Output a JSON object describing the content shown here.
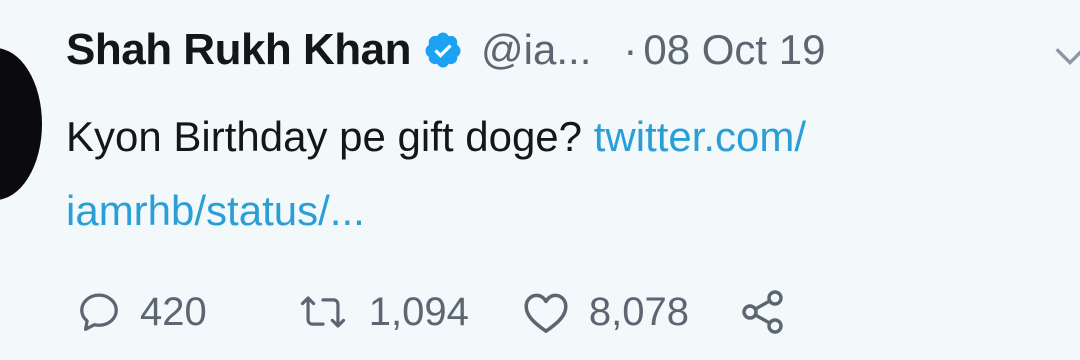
{
  "tweet": {
    "author_name": "Shah Rukh Khan",
    "handle": "@ia...",
    "separator": "·",
    "date": "08 Oct 19",
    "text_prefix": "Kyon Birthday pe gift doge? ",
    "link_part1": "twitter.com/",
    "link_part2": "iamrhb/status/...",
    "icons": {
      "verified": "verified-badge-icon",
      "caret": "chevron-down-icon",
      "reply": "reply-icon",
      "retweet": "retweet-icon",
      "like": "heart-icon",
      "share": "share-icon"
    },
    "colors": {
      "verified": "#1da1f2",
      "link": "#2a9fd6",
      "text": "#14171a",
      "muted": "#5b6670",
      "background": "#f3f8fb"
    }
  },
  "actions": {
    "replies": "420",
    "retweets": "1,094",
    "likes": "8,078"
  }
}
